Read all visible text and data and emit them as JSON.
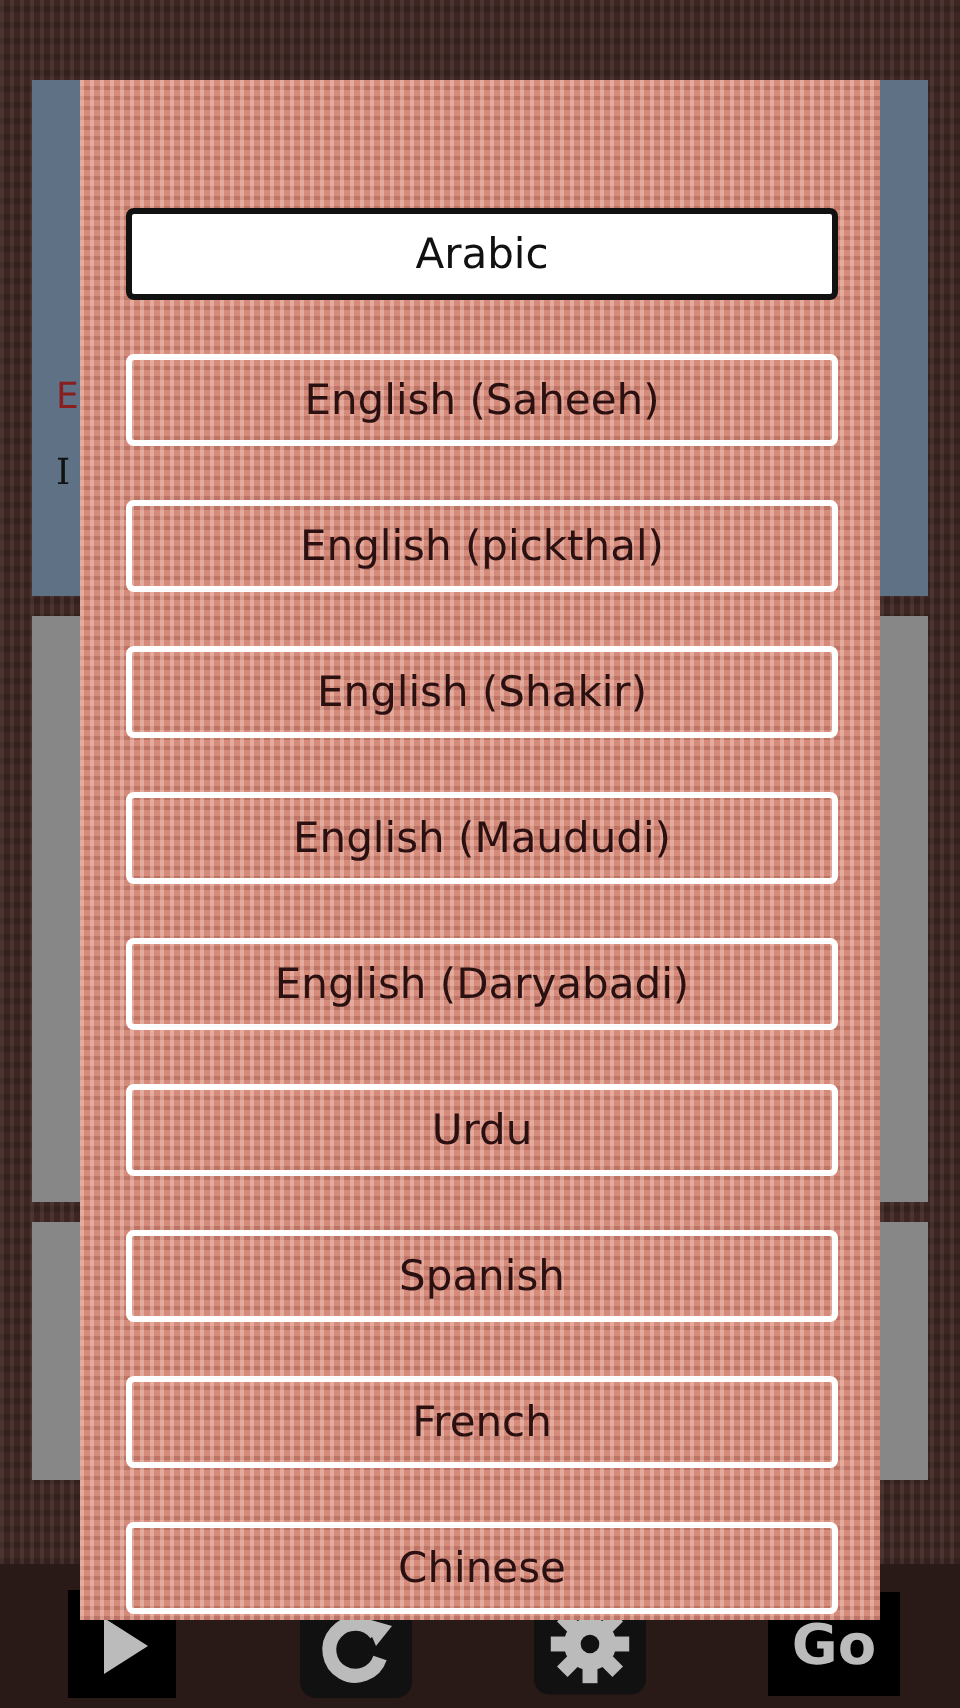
{
  "background_cards": [
    {
      "kind": "blue",
      "lines": [
        {
          "text": "E",
          "accent": true
        },
        {
          "text": "I",
          "accent": false
        }
      ]
    },
    {
      "kind": "grey"
    },
    {
      "kind": "grey"
    }
  ],
  "dialog": {
    "options": [
      {
        "label": "Arabic",
        "selected": true
      },
      {
        "label": "English (Saheeh)",
        "selected": false
      },
      {
        "label": "English (pickthal)",
        "selected": false
      },
      {
        "label": "English (Shakir)",
        "selected": false
      },
      {
        "label": "English (Maududi)",
        "selected": false
      },
      {
        "label": "English (Daryabadi)",
        "selected": false
      },
      {
        "label": "Urdu",
        "selected": false
      },
      {
        "label": "Spanish",
        "selected": false
      },
      {
        "label": "French",
        "selected": false
      },
      {
        "label": "Chinese",
        "selected": false
      }
    ]
  },
  "toolbar": [
    {
      "kind": "play"
    },
    {
      "kind": "refresh"
    },
    {
      "kind": "settings"
    },
    {
      "kind": "go",
      "label": "Go"
    }
  ]
}
